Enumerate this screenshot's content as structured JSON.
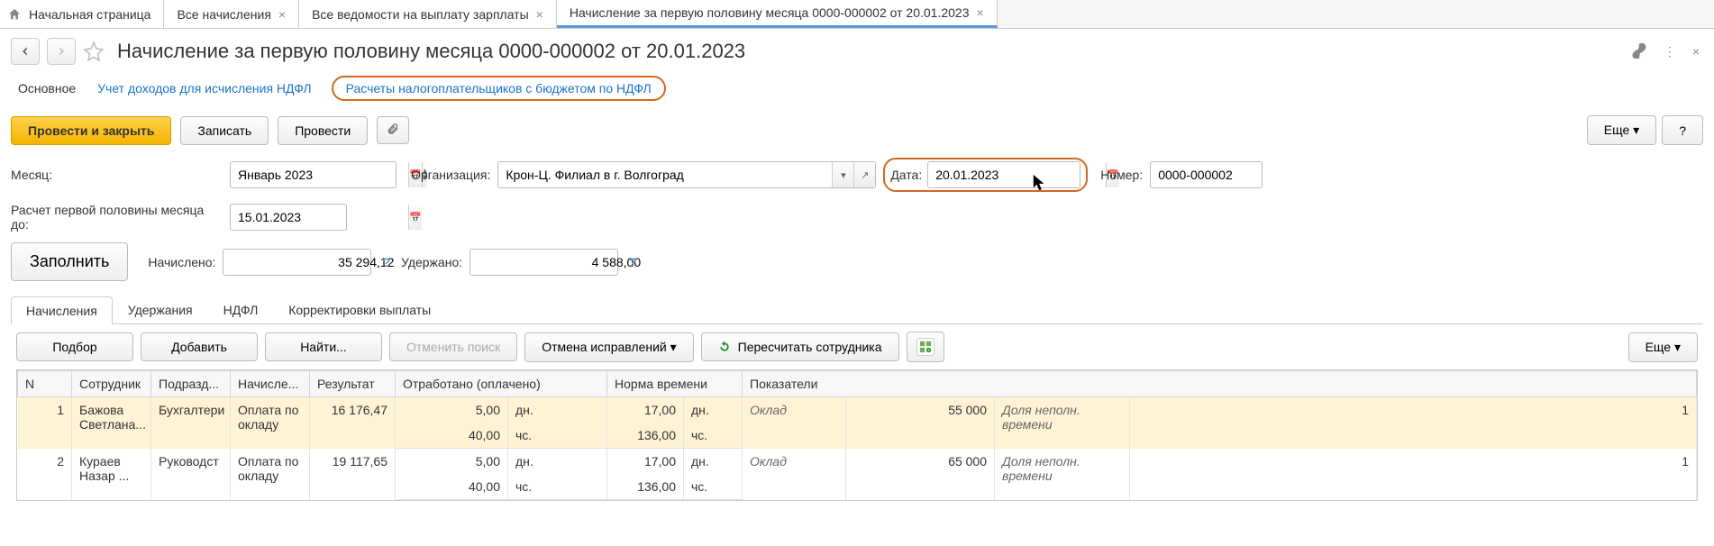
{
  "tabs": [
    {
      "label": "Начальная страница",
      "home": true
    },
    {
      "label": "Все начисления",
      "closable": true
    },
    {
      "label": "Все ведомости на выплату зарплаты",
      "closable": true
    },
    {
      "label": "Начисление за первую половину месяца 0000-000002 от 20.01.2023",
      "closable": true,
      "active": true
    }
  ],
  "page_title": "Начисление за первую половину месяца 0000-000002 от 20.01.2023",
  "subnav": {
    "main": "Основное",
    "link1": "Учет доходов для исчисления НДФЛ",
    "link2": "Расчеты налогоплательщиков с бюджетом по НДФЛ"
  },
  "cmd": {
    "post_close": "Провести и закрыть",
    "save": "Записать",
    "post": "Провести",
    "more": "Еще",
    "help": "?"
  },
  "form": {
    "month_label": "Месяц:",
    "month_value": "Январь 2023",
    "org_label": "Организация:",
    "org_value": "Крон-Ц. Филиал в г. Волгоград",
    "date_label": "Дата:",
    "date_value": "20.01.2023",
    "number_label": "Номер:",
    "number_value": "0000-000002",
    "half_label": "Расчет первой половины месяца до:",
    "half_value": "15.01.2023",
    "fill": "Заполнить",
    "accrued_label": "Начислено:",
    "accrued_value": "35 294,12",
    "withheld_label": "Удержано:",
    "withheld_value": "4 588,00"
  },
  "inner_tabs": [
    "Начисления",
    "Удержания",
    "НДФЛ",
    "Корректировки выплаты"
  ],
  "grid_toolbar": {
    "pick": "Подбор",
    "add": "Добавить",
    "find": "Найти...",
    "cancel_search": "Отменить поиск",
    "cancel_fix": "Отмена исправлений",
    "recalc": "Пересчитать сотрудника",
    "more": "Еще"
  },
  "grid": {
    "headers": {
      "n": "N",
      "emp": "Сотрудник",
      "dep": "Подразд...",
      "calc": "Начисле...",
      "res": "Результат",
      "worked": "Отработано (оплачено)",
      "norm": "Норма времени",
      "ind": "Показатели"
    },
    "rows": [
      {
        "n": "1",
        "emp": "Бажова Светлана...",
        "dep": "Бухгалтери",
        "calc": "Оплата по окладу",
        "res": "16 176,47",
        "wd": "5,00",
        "wdu": "дн.",
        "wh": "40,00",
        "whu": "чс.",
        "nd": "17,00",
        "ndu": "дн.",
        "nh": "136,00",
        "nhu": "чс.",
        "ind1_l": "Оклад",
        "ind1_v": "55 000",
        "ind2_l": "Доля неполн. времени",
        "ind2_v": "1",
        "sel": true
      },
      {
        "n": "2",
        "emp": "Кураев Назар ...",
        "dep": "Руководст",
        "calc": "Оплата по окладу",
        "res": "19 117,65",
        "wd": "5,00",
        "wdu": "дн.",
        "wh": "40,00",
        "whu": "чс.",
        "nd": "17,00",
        "ndu": "дн.",
        "nh": "136,00",
        "nhu": "чс.",
        "ind1_l": "Оклад",
        "ind1_v": "65 000",
        "ind2_l": "Доля неполн. времени",
        "ind2_v": "1"
      }
    ]
  }
}
